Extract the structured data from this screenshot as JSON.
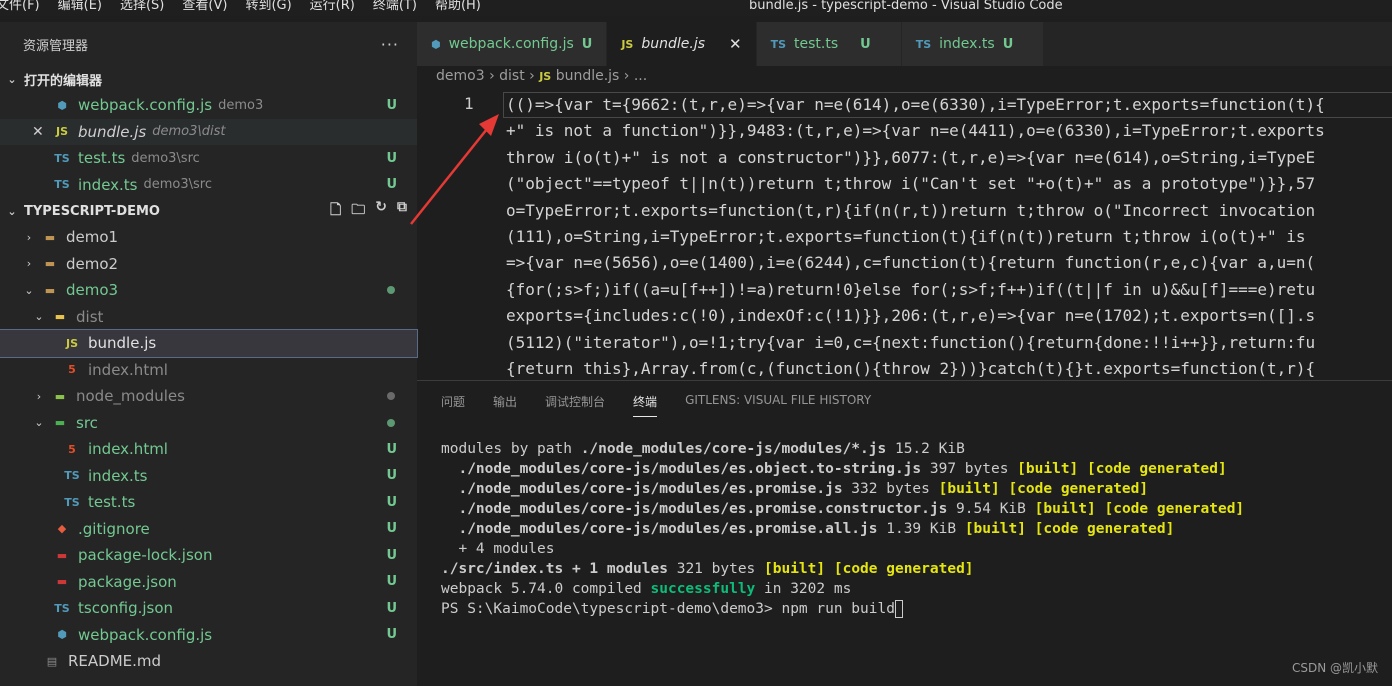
{
  "titlebar": {
    "menu": [
      "文件(F)",
      "编辑(E)",
      "选择(S)",
      "查看(V)",
      "转到(G)",
      "运行(R)",
      "终端(T)",
      "帮助(H)"
    ],
    "window_title": "bundle.js - typescript-demo - Visual Studio Code"
  },
  "sidebar": {
    "title": "资源管理器",
    "more": "···",
    "open_editors_title": "打开的编辑器",
    "open_editors": [
      {
        "name": "webpack.config.js",
        "hint": "demo3",
        "status": "U"
      },
      {
        "name": "bundle.js",
        "hint": "demo3\\dist",
        "close": "✕"
      },
      {
        "name": "test.ts",
        "hint": "demo3\\src",
        "status": "U"
      },
      {
        "name": "index.ts",
        "hint": "demo3\\src",
        "status": "U"
      }
    ],
    "workspace_title": "TYPESCRIPT-DEMO",
    "tree": [
      {
        "name": "demo1"
      },
      {
        "name": "demo2"
      },
      {
        "name": "demo3"
      },
      {
        "name": "dist"
      },
      {
        "name": "bundle.js"
      },
      {
        "name": "index.html"
      },
      {
        "name": "node_modules"
      },
      {
        "name": "src"
      },
      {
        "name": "index.html",
        "status": "U"
      },
      {
        "name": "index.ts",
        "status": "U"
      },
      {
        "name": "test.ts",
        "status": "U"
      },
      {
        "name": ".gitignore",
        "status": "U"
      },
      {
        "name": "package-lock.json",
        "status": "U"
      },
      {
        "name": "package.json",
        "status": "U"
      },
      {
        "name": "tsconfig.json",
        "status": "U"
      },
      {
        "name": "webpack.config.js",
        "status": "U"
      },
      {
        "name": "README.md"
      }
    ]
  },
  "tabs": [
    {
      "name": "webpack.config.js",
      "icon": "JS-gear",
      "status": "U"
    },
    {
      "name": "bundle.js",
      "icon": "JS",
      "close": "✕"
    },
    {
      "name": "test.ts",
      "icon": "TS",
      "status": "U"
    },
    {
      "name": "index.ts",
      "icon": "TS",
      "status": "U"
    }
  ],
  "breadcrumb": {
    "parts": [
      "demo3",
      "dist",
      "bundle.js",
      "..."
    ]
  },
  "editor": {
    "line_number": "1",
    "lines": [
      "(()=>{var t={9662:(t,r,e)=>{var n=e(614),o=e(6330),i=TypeError;t.exports=function(t){",
      "+\" is not a function\")}},9483:(t,r,e)=>{var n=e(4411),o=e(6330),i=TypeError;t.exports",
      "throw i(o(t)+\" is not a constructor\")}},6077:(t,r,e)=>{var n=e(614),o=String,i=TypeE",
      "(\"object\"==typeof t||n(t))return t;throw i(\"Can't set \"+o(t)+\" as a prototype\")}},57",
      "o=TypeError;t.exports=function(t,r){if(n(r,t))return t;throw o(\"Incorrect invocation",
      "(111),o=String,i=TypeError;t.exports=function(t){if(n(t))return t;throw i(o(t)+\" is",
      "=>{var n=e(5656),o=e(1400),i=e(6244),c=function(t){return function(r,e,c){var a,u=n(",
      "{for(;s>f;)if((a=u[f++])!=a)return!0}else for(;s>f;f++)if((t||f in u)&&u[f]===e)retu",
      "exports={includes:c(!0),indexOf:c(!1)}},206:(t,r,e)=>{var n=e(1702);t.exports=n([].s",
      "(5112)(\"iterator\"),o=!1;try{var i=0,c={next:function(){return{done:!!i++}},return:fu",
      "{return this},Array.from(c,(function(){throw 2}))}catch(t){}t.exports=function(t,r){"
    ]
  },
  "panel": {
    "tabs": [
      "问题",
      "输出",
      "调试控制台",
      "终端",
      "GITLENS: VISUAL FILE HISTORY"
    ],
    "terminal": {
      "l1_a": "modules by path ",
      "l1_b": "./node_modules/core-js/modules/*.js",
      "l1_c": " 15.2 KiB",
      "l2_a": "  ./node_modules/core-js/modules/es.object.to-string.js",
      "l2_b": " 397 bytes ",
      "l2_c": "[built] [code generated]",
      "l3_a": "  ./node_modules/core-js/modules/es.promise.js",
      "l3_b": " 332 bytes ",
      "l3_c": "[built] [code generated]",
      "l4_a": "  ./node_modules/core-js/modules/es.promise.constructor.js",
      "l4_b": " 9.54 KiB ",
      "l4_c": "[built] [code generated]",
      "l5_a": "  ./node_modules/core-js/modules/es.promise.all.js",
      "l5_b": " 1.39 KiB ",
      "l5_c": "[built] [code generated]",
      "l6": "  + 4 modules",
      "l7_a": "./src/index.ts + 1 modules",
      "l7_b": " 321 bytes ",
      "l7_c": "[built] [code generated]",
      "l8_a": "webpack 5.74.0 compiled ",
      "l8_b": "successfully",
      "l8_c": " in 3202 ms",
      "l9": "PS S:\\KaimoCode\\typescript-demo\\demo3> npm run build"
    }
  },
  "watermark": "CSDN @凯小默",
  "colors": {
    "accent": "#007acc",
    "git_untracked": "#73c991",
    "terminal_yellow": "#e5e510",
    "terminal_green": "#0dbc79",
    "arrow": "#e53935"
  }
}
